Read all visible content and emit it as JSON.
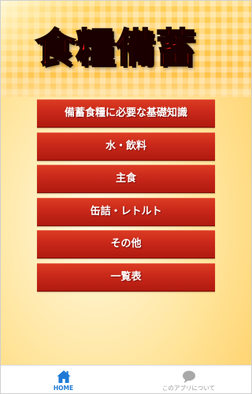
{
  "app": {
    "title": "食糧備蓄"
  },
  "menu": {
    "items": [
      {
        "label": "備蓄食糧に必要な基礎知識"
      },
      {
        "label": "水・飲料"
      },
      {
        "label": "主食"
      },
      {
        "label": "缶詰・レトルト"
      },
      {
        "label": "その他"
      },
      {
        "label": "一覧表"
      }
    ]
  },
  "tabbar": {
    "tabs": [
      {
        "label": "HOME",
        "icon": "home-icon",
        "active": true
      },
      {
        "label": "このアプリについて",
        "icon": "chat-bubble-icon",
        "active": false
      }
    ]
  },
  "colors": {
    "title_red": "#e01b10",
    "button_red": "#c8281a",
    "active_tab_blue": "#1f7ad6",
    "inactive_tab_gray": "#9a9a9a",
    "header_orange": "#ffc54d"
  }
}
